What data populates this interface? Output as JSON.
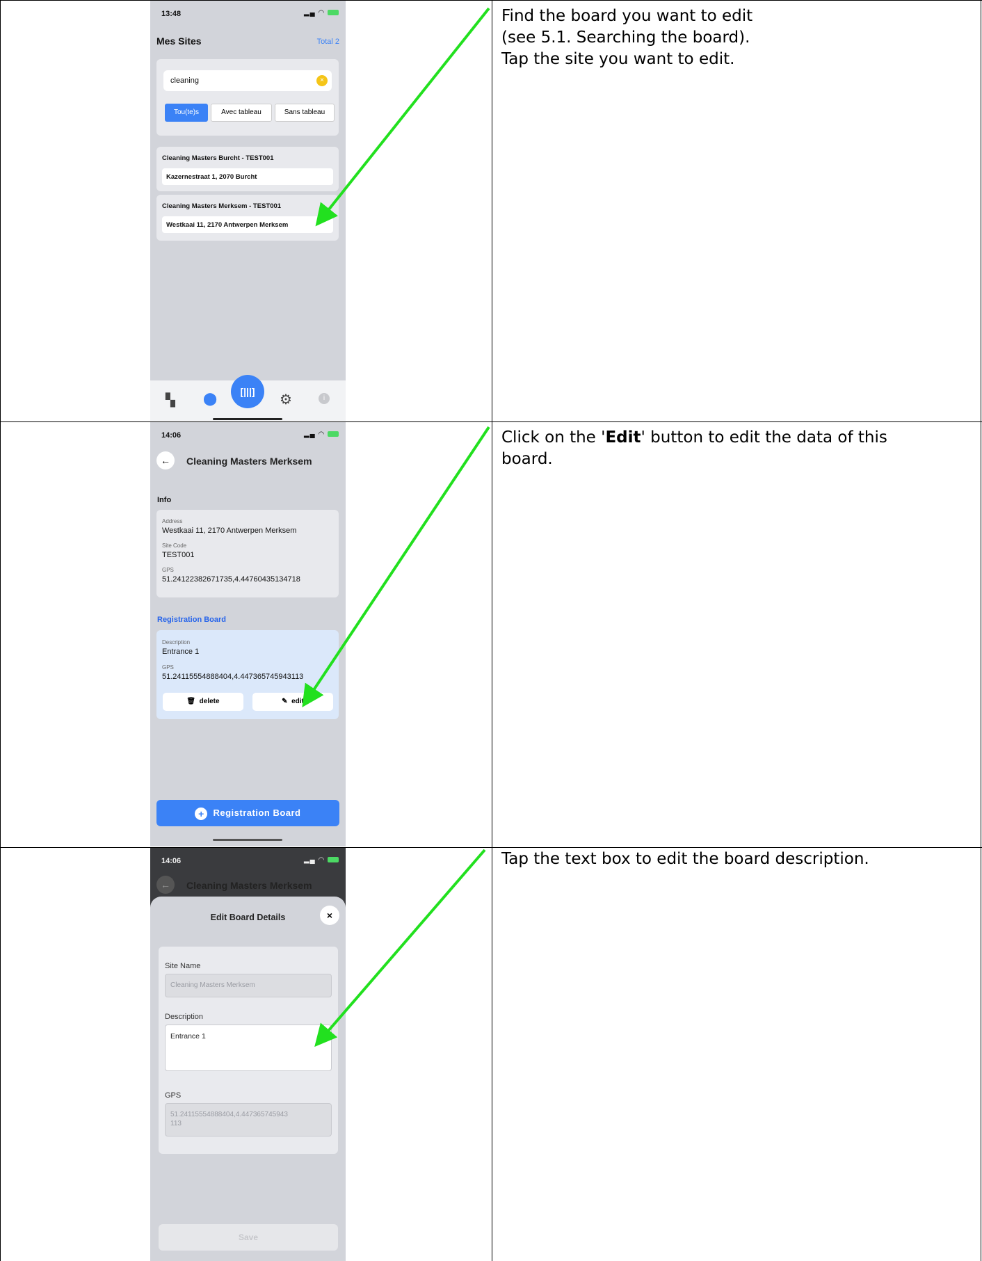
{
  "rows": [
    {
      "instruction_lines": [
        "Find the board you want to edit",
        "(see 5.1. Searching the board).",
        "Tap the site you want to edit."
      ]
    },
    {
      "instruction_before": "Click on the '",
      "instruction_bold": "Edit",
      "instruction_after": "' button to edit the data of this",
      "instruction_line2": "board."
    },
    {
      "instruction_lines": [
        "Tap the text box to edit the board description."
      ]
    }
  ],
  "screen1": {
    "time": "13:48",
    "title": "Mes Sites",
    "total": "Total 2",
    "search_value": "cleaning",
    "filters": [
      "Tou(te)s",
      "Avec tableau",
      "Sans tableau"
    ],
    "sites": [
      {
        "name": "Cleaning Masters Burcht - TEST001",
        "address": "Kazernestraat 1, 2070 Burcht"
      },
      {
        "name": "Cleaning Masters Merksem - TEST001",
        "address": "Westkaai 11, 2170 Antwerpen Merksem"
      }
    ]
  },
  "screen2": {
    "time": "14:06",
    "title": "Cleaning Masters Merksem",
    "info_heading": "Info",
    "address_label": "Address",
    "address_value": "Westkaai 11, 2170 Antwerpen Merksem",
    "sitecode_label": "Site Code",
    "sitecode_value": "TEST001",
    "gps_label": "GPS",
    "gps_value": "51.24122382671735,4.44760435134718",
    "reg_heading": "Registration Board",
    "desc_label": "Description",
    "desc_value": "Entrance 1",
    "board_gps_label": "GPS",
    "board_gps_value": "51.24115554888404,4.447365745943113",
    "delete_label": "delete",
    "edit_label": "edit",
    "add_button_label": "Registration Board"
  },
  "screen3": {
    "time": "14:06",
    "bg_title": "Cleaning Masters Merksem",
    "modal_title": "Edit Board Details",
    "site_name_label": "Site Name",
    "site_name_value": "Cleaning Masters Merksem",
    "description_label": "Description",
    "description_value": "Entrance 1",
    "gps_label": "GPS",
    "gps_line1": "51.24115554888404,4.447365745943",
    "gps_line2": "113",
    "save_label": "Save"
  },
  "colors": {
    "accent": "#3b82f6",
    "arrow": "#22e01f",
    "phone_bg": "#d2d4da",
    "highlight_card": "#dbe8fa"
  }
}
